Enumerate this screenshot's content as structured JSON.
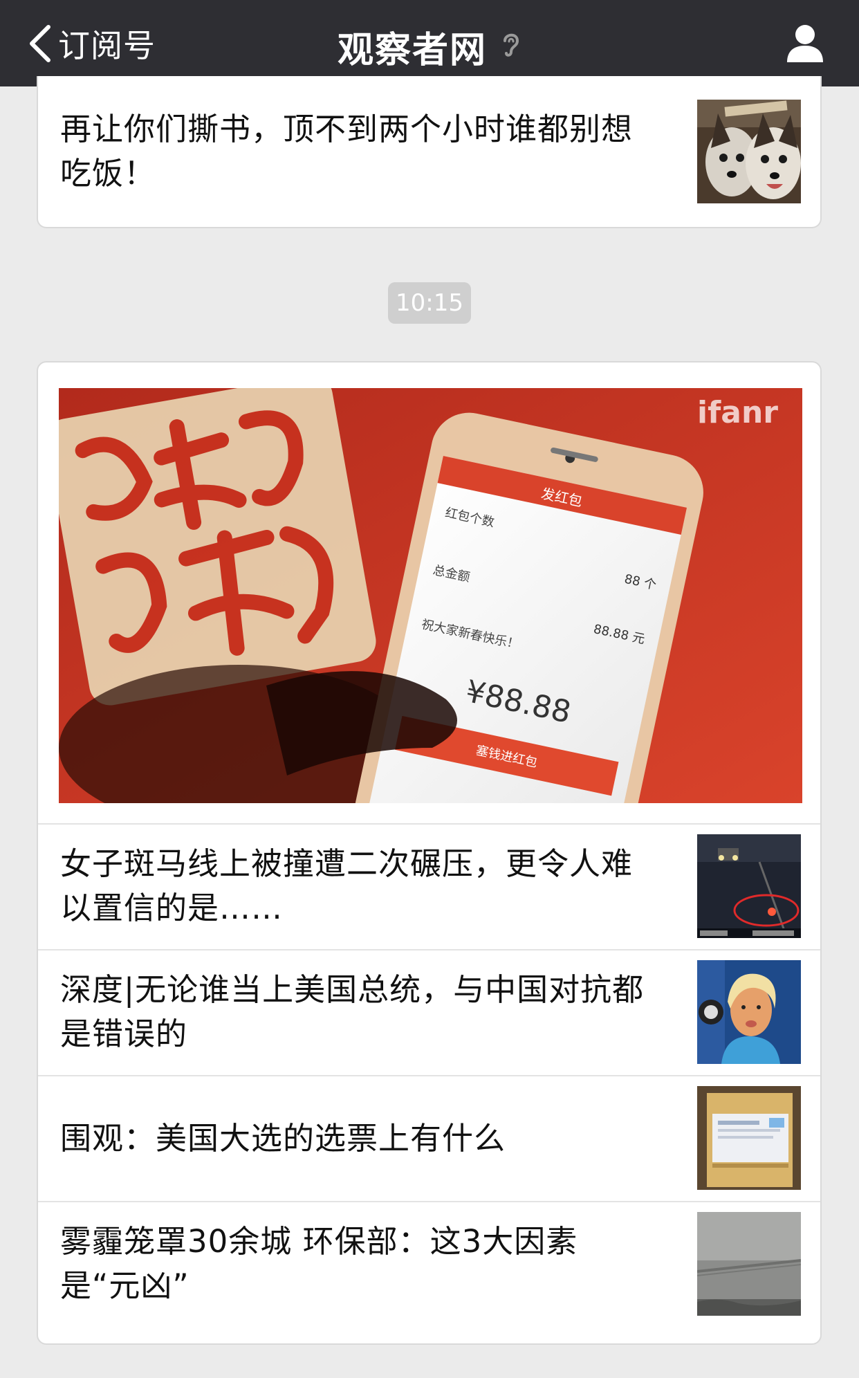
{
  "nav": {
    "back_label": "订阅号",
    "title": "观察者网"
  },
  "top_card": {
    "title": "再让你们撕书，顶不到两个小时谁都别想吃饭！"
  },
  "timestamp": "10:15",
  "main_card": {
    "cover": {
      "watermark": "ifanr",
      "phone_amount": "¥88.88",
      "phone_header": "发红包",
      "phone_count_label": "红包个数",
      "phone_count_value": "88 个",
      "phone_total_label": "总金额",
      "phone_total_value": "88.88 元",
      "phone_greeting": "祝大家新春快乐！",
      "phone_button": "塞钱进红包"
    },
    "items": [
      {
        "title": "女子斑马线上被撞遭二次碾压，更令人难以置信的是……"
      },
      {
        "title": "深度|无论谁当上美国总统，与中国对抗都是错误的"
      },
      {
        "title": "围观：美国大选的选票上有什么"
      },
      {
        "title": "雾霾笼罩30余城 环保部：这3大因素是“元凶”"
      }
    ]
  },
  "colors": {
    "navbar": "#2e2e33",
    "background": "#ebebeb",
    "cover_red": "#c8321f"
  }
}
